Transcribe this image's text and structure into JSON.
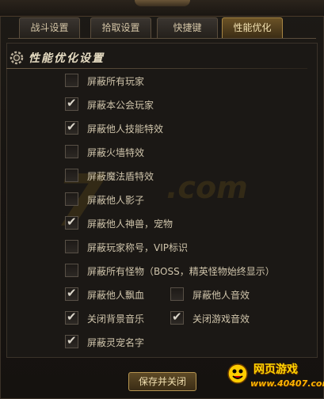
{
  "tabs": [
    {
      "label": "战斗设置",
      "active": false
    },
    {
      "label": "拾取设置",
      "active": false
    },
    {
      "label": "快捷键",
      "active": false
    },
    {
      "label": "性能优化",
      "active": true
    }
  ],
  "section": {
    "title": "性能优化设置",
    "icon": "gear-icon"
  },
  "options": [
    {
      "label": "屏蔽所有玩家",
      "checked": false
    },
    {
      "label": "屏蔽本公会玩家",
      "checked": true
    },
    {
      "label": "屏蔽他人技能特效",
      "checked": true
    },
    {
      "label": "屏蔽火墙特效",
      "checked": false
    },
    {
      "label": "屏蔽魔法盾特效",
      "checked": false
    },
    {
      "label": "屏蔽他人影子",
      "checked": false
    },
    {
      "label": "屏蔽他人神兽，宠物",
      "checked": true
    },
    {
      "label": "屏蔽玩家称号，VIP标识",
      "checked": false
    },
    {
      "label": "屏蔽所有怪物（BOSS，精英怪物始终显示）",
      "checked": false
    },
    {
      "label": "屏蔽他人飘血",
      "checked": true
    },
    {
      "label": "屏蔽他人音效",
      "checked": false
    },
    {
      "label": "关闭背景音乐",
      "checked": true
    },
    {
      "label": "关闭游戏音效",
      "checked": true
    },
    {
      "label": "屏蔽灵宠名字",
      "checked": true
    }
  ],
  "save_button": "保存并关闭",
  "logo": {
    "line1": "网页游戏",
    "line2": "www.40407.com"
  },
  "colors": {
    "accent": "#a78543",
    "text": "#cfc4ab",
    "background": "#1b1815"
  }
}
